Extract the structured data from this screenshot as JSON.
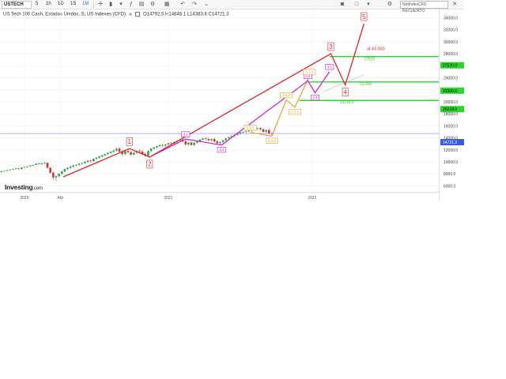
{
  "toolbar": {
    "symbol": "USTECH",
    "intervals": [
      "5",
      "1h",
      "1D",
      "1S",
      "1M"
    ],
    "active_interval": "1S",
    "right_box": "NotIndexCFD RECUENTO",
    "icons": [
      "crosshair-icon",
      "candles-icon",
      "bar-type-icon",
      "indicators-icon",
      "gear-icon",
      "undo-icon",
      "redo-icon",
      "template-icon",
      "camera-icon",
      "fullscreen-icon",
      "settings-icon",
      "close-icon"
    ]
  },
  "legend": {
    "instrument": "US Tech 100 Cash, Estados Unidos, S, US Indexes (CFD)",
    "ohlc": [
      {
        "k": "O",
        "v": "14792.5"
      },
      {
        "k": "H",
        "v": "14848.1"
      },
      {
        "k": "L",
        "v": "14383.6"
      },
      {
        "k": "C",
        "v": "14721.3"
      }
    ]
  },
  "watermark": {
    "brand": "Investing",
    "suffix": ".com"
  },
  "colors": {
    "up": "#2ea04a",
    "down": "#d32f2f",
    "impulse": "#e0242b",
    "magenta": "#d017d8",
    "orange": "#f0a020",
    "green_level": "#2bd62b",
    "blue_level": "#7a7aff"
  },
  "chart_data": {
    "type": "candlestick",
    "title": "",
    "y_ticks": [
      "34000.0",
      "32000.0",
      "30000.0",
      "28000.0",
      "26000.0",
      "24000.0",
      "22000.0",
      "20000.0",
      "18000.0",
      "16000.0",
      "14000.0",
      "12000.0",
      "10000.0",
      "8000.0",
      "6000.0"
    ],
    "ylim": [
      5000,
      35500
    ],
    "x_ticks": [
      {
        "label": "2020",
        "t": 2020.0
      },
      {
        "label": "Abr",
        "t": 2020.25
      },
      {
        "label": "2021",
        "t": 2021.0
      },
      {
        "label": "2022",
        "t": 2022.0
      }
    ],
    "xlim": [
      2019.83,
      2022.88
    ],
    "last_price": {
      "label": "14721.3",
      "value": 14721.3
    },
    "levels": [
      {
        "value": 27520,
        "axis_label": "27520.0",
        "text": "27520",
        "color": "green"
      },
      {
        "value": 23300,
        "axis_label": "23300.0",
        "text": "23.300",
        "color": "green"
      },
      {
        "value": 20218,
        "axis_label": "20218.0",
        "text": "20218.0",
        "color": "green"
      }
    ],
    "annotations": [
      {
        "text": "al 43.000",
        "t": 2022.38,
        "value": 28600,
        "color": "red"
      }
    ],
    "impulse_wave": {
      "labels": [
        "1",
        "2",
        "3",
        "4",
        "5"
      ],
      "points": [
        {
          "t": 2020.27,
          "v": 7500
        },
        {
          "t": 2020.73,
          "v": 12200,
          "label": "1"
        },
        {
          "t": 2020.87,
          "v": 10800,
          "label": "2"
        },
        {
          "t": 2022.13,
          "v": 28000,
          "label": "3"
        },
        {
          "t": 2022.23,
          "v": 22800,
          "label": "4"
        },
        {
          "t": 2022.36,
          "v": 33000,
          "label": "5"
        }
      ]
    },
    "sub_wave_magenta": {
      "labels": [
        "3.1",
        "3.2",
        "3.3",
        "3.4",
        "3.5"
      ],
      "points": [
        {
          "t": 2020.87,
          "v": 10800
        },
        {
          "t": 2021.12,
          "v": 13800,
          "label": "3.1"
        },
        {
          "t": 2021.37,
          "v": 12800,
          "label": "3.2"
        },
        {
          "t": 2021.97,
          "v": 23500,
          "label": "3.3"
        },
        {
          "t": 2022.02,
          "v": 21500,
          "label": "3.4"
        },
        {
          "t": 2022.12,
          "v": 25000,
          "label": "3.5"
        }
      ]
    },
    "sub_wave_orange": {
      "labels": [
        "3.3.1",
        "3.3.2",
        "3.3.3",
        "3.3.4",
        "3.3.5"
      ],
      "points": [
        {
          "t": 2021.57,
          "v": 14900,
          "label": "3.3.1"
        },
        {
          "t": 2021.72,
          "v": 14300,
          "label": "3.3.2"
        },
        {
          "t": 2021.82,
          "v": 20300,
          "label": "3.3.3"
        },
        {
          "t": 2021.88,
          "v": 19100,
          "label": "3.3.4"
        },
        {
          "t": 2021.98,
          "v": 24200,
          "label": "3.3.5"
        }
      ]
    },
    "dashed_trend": {
      "from": {
        "t": 2022.07,
        "v": 21600
      },
      "to": {
        "t": 2022.36,
        "v": 24500
      }
    },
    "candles": [
      {
        "t": 2019.84,
        "o": 8300,
        "h": 8500,
        "l": 8200,
        "c": 8450
      },
      {
        "t": 2019.86,
        "o": 8450,
        "h": 8550,
        "l": 8350,
        "c": 8500
      },
      {
        "t": 2019.88,
        "o": 8500,
        "h": 8700,
        "l": 8400,
        "c": 8600
      },
      {
        "t": 2019.9,
        "o": 8600,
        "h": 8750,
        "l": 8500,
        "c": 8700
      },
      {
        "t": 2019.92,
        "o": 8700,
        "h": 8850,
        "l": 8600,
        "c": 8800
      },
      {
        "t": 2019.94,
        "o": 8800,
        "h": 8950,
        "l": 8700,
        "c": 8900
      },
      {
        "t": 2019.96,
        "o": 8900,
        "h": 9000,
        "l": 8700,
        "c": 8800
      },
      {
        "t": 2019.98,
        "o": 8800,
        "h": 9100,
        "l": 8750,
        "c": 9050
      },
      {
        "t": 2020.0,
        "o": 9050,
        "h": 9200,
        "l": 8950,
        "c": 9150
      },
      {
        "t": 2020.02,
        "o": 9150,
        "h": 9300,
        "l": 9000,
        "c": 9250
      },
      {
        "t": 2020.04,
        "o": 9250,
        "h": 9450,
        "l": 9150,
        "c": 9400
      },
      {
        "t": 2020.06,
        "o": 9400,
        "h": 9550,
        "l": 9300,
        "c": 9500
      },
      {
        "t": 2020.08,
        "o": 9500,
        "h": 9750,
        "l": 9400,
        "c": 9700
      },
      {
        "t": 2020.1,
        "o": 9700,
        "h": 9850,
        "l": 9550,
        "c": 9600
      },
      {
        "t": 2020.12,
        "o": 9600,
        "h": 9800,
        "l": 9500,
        "c": 9750
      },
      {
        "t": 2020.14,
        "o": 9750,
        "h": 9950,
        "l": 9600,
        "c": 9850
      },
      {
        "t": 2020.16,
        "o": 9850,
        "h": 9900,
        "l": 8900,
        "c": 9000
      },
      {
        "t": 2020.18,
        "o": 9000,
        "h": 9100,
        "l": 8000,
        "c": 8200
      },
      {
        "t": 2020.2,
        "o": 8200,
        "h": 8400,
        "l": 7000,
        "c": 7400
      },
      {
        "t": 2020.22,
        "o": 7400,
        "h": 7800,
        "l": 6800,
        "c": 7600
      },
      {
        "t": 2020.24,
        "o": 7600,
        "h": 8100,
        "l": 7400,
        "c": 8000
      },
      {
        "t": 2020.26,
        "o": 8000,
        "h": 8500,
        "l": 7800,
        "c": 8400
      },
      {
        "t": 2020.28,
        "o": 8400,
        "h": 8900,
        "l": 8200,
        "c": 8800
      },
      {
        "t": 2020.3,
        "o": 8800,
        "h": 9100,
        "l": 8600,
        "c": 9000
      },
      {
        "t": 2020.32,
        "o": 9000,
        "h": 9300,
        "l": 8800,
        "c": 9200
      },
      {
        "t": 2020.34,
        "o": 9200,
        "h": 9500,
        "l": 9000,
        "c": 9400
      },
      {
        "t": 2020.36,
        "o": 9400,
        "h": 9600,
        "l": 9200,
        "c": 9500
      },
      {
        "t": 2020.38,
        "o": 9500,
        "h": 9800,
        "l": 9300,
        "c": 9700
      },
      {
        "t": 2020.4,
        "o": 9700,
        "h": 9900,
        "l": 9500,
        "c": 9800
      },
      {
        "t": 2020.42,
        "o": 9800,
        "h": 10100,
        "l": 9600,
        "c": 10000
      },
      {
        "t": 2020.44,
        "o": 10000,
        "h": 10300,
        "l": 9800,
        "c": 10200
      },
      {
        "t": 2020.46,
        "o": 10200,
        "h": 10400,
        "l": 9900,
        "c": 10100
      },
      {
        "t": 2020.48,
        "o": 10100,
        "h": 10600,
        "l": 10000,
        "c": 10500
      },
      {
        "t": 2020.5,
        "o": 10500,
        "h": 10800,
        "l": 10300,
        "c": 10700
      },
      {
        "t": 2020.52,
        "o": 10700,
        "h": 11000,
        "l": 10500,
        "c": 10900
      },
      {
        "t": 2020.54,
        "o": 10900,
        "h": 11200,
        "l": 10700,
        "c": 11100
      },
      {
        "t": 2020.56,
        "o": 11100,
        "h": 11400,
        "l": 10900,
        "c": 11300
      },
      {
        "t": 2020.58,
        "o": 11300,
        "h": 11600,
        "l": 11100,
        "c": 11500
      },
      {
        "t": 2020.6,
        "o": 11500,
        "h": 11800,
        "l": 11300,
        "c": 11700
      },
      {
        "t": 2020.62,
        "o": 11700,
        "h": 12000,
        "l": 11500,
        "c": 11900
      },
      {
        "t": 2020.64,
        "o": 11900,
        "h": 12300,
        "l": 11700,
        "c": 12200
      },
      {
        "t": 2020.66,
        "o": 12200,
        "h": 12500,
        "l": 11500,
        "c": 11700
      },
      {
        "t": 2020.68,
        "o": 11700,
        "h": 12000,
        "l": 11000,
        "c": 11300
      },
      {
        "t": 2020.7,
        "o": 11300,
        "h": 11900,
        "l": 11100,
        "c": 11800
      },
      {
        "t": 2020.72,
        "o": 11800,
        "h": 12200,
        "l": 11400,
        "c": 11600
      },
      {
        "t": 2020.74,
        "o": 11600,
        "h": 11800,
        "l": 11000,
        "c": 11200
      },
      {
        "t": 2020.76,
        "o": 11200,
        "h": 11700,
        "l": 11000,
        "c": 11500
      },
      {
        "t": 2020.78,
        "o": 11500,
        "h": 11900,
        "l": 11300,
        "c": 11800
      },
      {
        "t": 2020.8,
        "o": 11800,
        "h": 12100,
        "l": 11500,
        "c": 11700
      },
      {
        "t": 2020.82,
        "o": 11700,
        "h": 12000,
        "l": 11200,
        "c": 11300
      },
      {
        "t": 2020.84,
        "o": 11300,
        "h": 11600,
        "l": 10900,
        "c": 11000
      },
      {
        "t": 2020.86,
        "o": 11000,
        "h": 11900,
        "l": 10900,
        "c": 11800
      },
      {
        "t": 2020.88,
        "o": 11800,
        "h": 12300,
        "l": 11600,
        "c": 12200
      },
      {
        "t": 2020.9,
        "o": 12200,
        "h": 12500,
        "l": 12000,
        "c": 12400
      },
      {
        "t": 2020.92,
        "o": 12400,
        "h": 12700,
        "l": 12200,
        "c": 12600
      },
      {
        "t": 2020.94,
        "o": 12600,
        "h": 12900,
        "l": 12400,
        "c": 12800
      },
      {
        "t": 2020.96,
        "o": 12800,
        "h": 13000,
        "l": 12500,
        "c": 12700
      },
      {
        "t": 2020.98,
        "o": 12700,
        "h": 13000,
        "l": 12500,
        "c": 12900
      },
      {
        "t": 2021.0,
        "o": 12900,
        "h": 13200,
        "l": 12700,
        "c": 13100
      },
      {
        "t": 2021.02,
        "o": 13100,
        "h": 13300,
        "l": 12800,
        "c": 13000
      },
      {
        "t": 2021.04,
        "o": 13000,
        "h": 13400,
        "l": 12900,
        "c": 13300
      },
      {
        "t": 2021.06,
        "o": 13300,
        "h": 13600,
        "l": 13100,
        "c": 13500
      },
      {
        "t": 2021.08,
        "o": 13500,
        "h": 13800,
        "l": 13300,
        "c": 13700
      },
      {
        "t": 2021.1,
        "o": 13700,
        "h": 13900,
        "l": 13300,
        "c": 13400
      },
      {
        "t": 2021.12,
        "o": 13400,
        "h": 13600,
        "l": 12700,
        "c": 12900
      },
      {
        "t": 2021.14,
        "o": 12900,
        "h": 13300,
        "l": 12600,
        "c": 13200
      },
      {
        "t": 2021.16,
        "o": 13200,
        "h": 13400,
        "l": 12700,
        "c": 12800
      },
      {
        "t": 2021.18,
        "o": 12800,
        "h": 13300,
        "l": 12600,
        "c": 13200
      },
      {
        "t": 2021.2,
        "o": 13200,
        "h": 13500,
        "l": 13000,
        "c": 13400
      },
      {
        "t": 2021.22,
        "o": 13400,
        "h": 13800,
        "l": 13200,
        "c": 13700
      },
      {
        "t": 2021.24,
        "o": 13700,
        "h": 14000,
        "l": 13500,
        "c": 13900
      },
      {
        "t": 2021.26,
        "o": 13900,
        "h": 14100,
        "l": 13600,
        "c": 13800
      },
      {
        "t": 2021.28,
        "o": 13800,
        "h": 14000,
        "l": 13400,
        "c": 13600
      },
      {
        "t": 2021.3,
        "o": 13600,
        "h": 13900,
        "l": 13300,
        "c": 13800
      },
      {
        "t": 2021.32,
        "o": 13800,
        "h": 14000,
        "l": 13300,
        "c": 13400
      },
      {
        "t": 2021.34,
        "o": 13400,
        "h": 13600,
        "l": 12900,
        "c": 13100
      },
      {
        "t": 2021.36,
        "o": 13100,
        "h": 13400,
        "l": 12900,
        "c": 13300
      },
      {
        "t": 2021.38,
        "o": 13300,
        "h": 13700,
        "l": 13100,
        "c": 13600
      },
      {
        "t": 2021.4,
        "o": 13600,
        "h": 14000,
        "l": 13500,
        "c": 13900
      },
      {
        "t": 2021.42,
        "o": 13900,
        "h": 14200,
        "l": 13700,
        "c": 14100
      },
      {
        "t": 2021.44,
        "o": 14100,
        "h": 14400,
        "l": 13900,
        "c": 14300
      },
      {
        "t": 2021.46,
        "o": 14300,
        "h": 14600,
        "l": 14100,
        "c": 14500
      },
      {
        "t": 2021.48,
        "o": 14500,
        "h": 14800,
        "l": 14300,
        "c": 14700
      },
      {
        "t": 2021.5,
        "o": 14700,
        "h": 15000,
        "l": 14500,
        "c": 14900
      },
      {
        "t": 2021.52,
        "o": 14900,
        "h": 15100,
        "l": 14700,
        "c": 15000
      },
      {
        "t": 2021.54,
        "o": 15000,
        "h": 15200,
        "l": 14800,
        "c": 15100
      },
      {
        "t": 2021.56,
        "o": 15100,
        "h": 15300,
        "l": 14900,
        "c": 15200
      },
      {
        "t": 2021.58,
        "o": 15200,
        "h": 15500,
        "l": 15000,
        "c": 15400
      },
      {
        "t": 2021.6,
        "o": 15400,
        "h": 15600,
        "l": 15200,
        "c": 15500
      },
      {
        "t": 2021.62,
        "o": 15500,
        "h": 15700,
        "l": 15300,
        "c": 15600
      },
      {
        "t": 2021.64,
        "o": 15600,
        "h": 15800,
        "l": 15200,
        "c": 15400
      },
      {
        "t": 2021.66,
        "o": 15400,
        "h": 15600,
        "l": 14900,
        "c": 15000
      },
      {
        "t": 2021.68,
        "o": 15000,
        "h": 15400,
        "l": 14800,
        "c": 15300
      },
      {
        "t": 2021.7,
        "o": 15300,
        "h": 15500,
        "l": 14600,
        "c": 14700
      },
      {
        "t": 2021.72,
        "o": 14792.5,
        "h": 14848.1,
        "l": 14383.6,
        "c": 14721.3
      }
    ]
  }
}
